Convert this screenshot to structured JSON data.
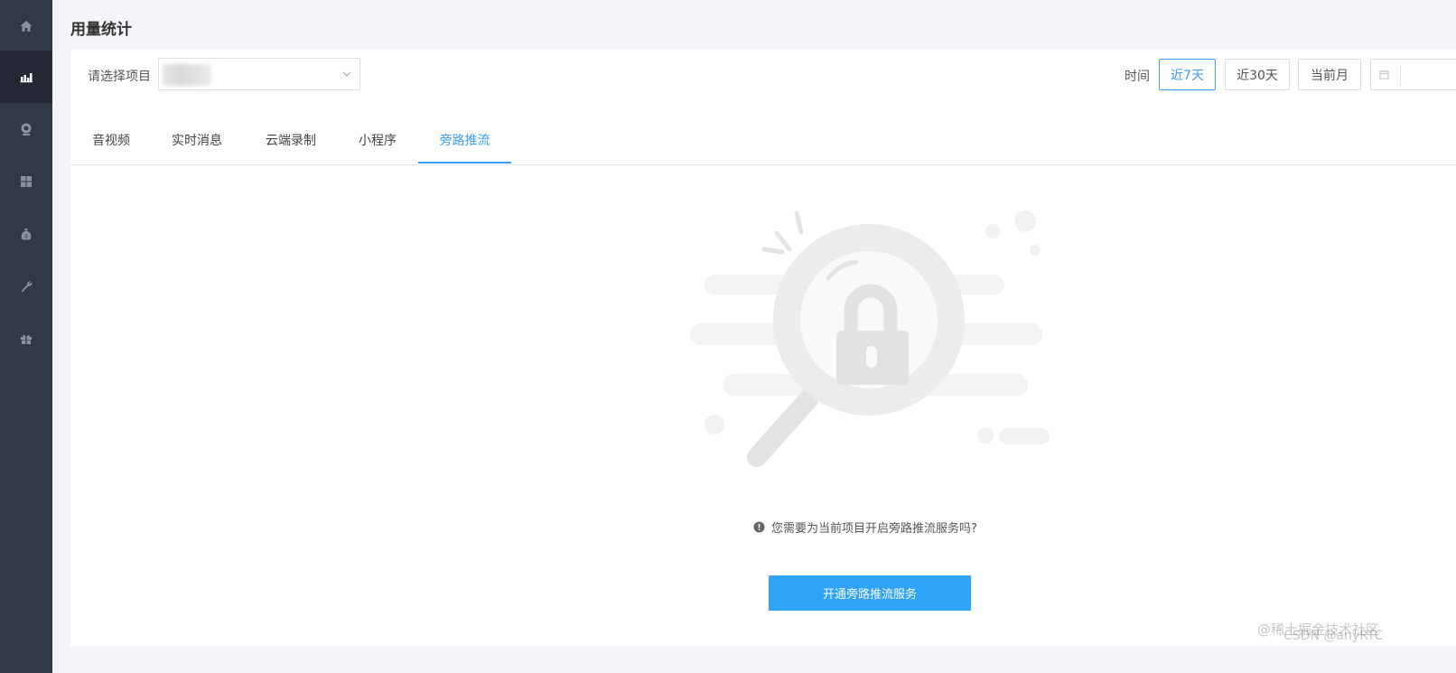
{
  "page": {
    "title": "用量统计"
  },
  "sidebar": {
    "items": [
      {
        "icon": "home-icon",
        "active": false
      },
      {
        "icon": "bar-chart-icon",
        "active": true
      },
      {
        "icon": "webcam-icon",
        "active": false
      },
      {
        "icon": "grid-icon",
        "active": false
      },
      {
        "icon": "money-bag-icon",
        "active": false
      },
      {
        "icon": "wrench-icon",
        "active": false
      },
      {
        "icon": "gift-icon",
        "active": false
      }
    ]
  },
  "filter": {
    "project_label": "请选择项目",
    "time_label": "时间",
    "ranges": [
      {
        "label": "近7天",
        "active": true
      },
      {
        "label": "近30天",
        "active": false
      },
      {
        "label": "当前月",
        "active": false
      }
    ]
  },
  "tabs": [
    {
      "label": "音视频",
      "active": false
    },
    {
      "label": "实时消息",
      "active": false
    },
    {
      "label": "云端录制",
      "active": false
    },
    {
      "label": "小程序",
      "active": false
    },
    {
      "label": "旁路推流",
      "active": true
    }
  ],
  "empty_state": {
    "illustration": "magnifier-lock-icon",
    "message": "您需要为当前项目开启旁路推流服务吗?",
    "action_label": "开通旁路推流服务"
  },
  "watermarks": {
    "juejin": "@稀土掘金技术社区",
    "csdn": "CSDN @anyRTC"
  },
  "colors": {
    "accent": "#3b9cf4",
    "button": "#2fa3f5",
    "sidebar": "#313848",
    "sidebar_active": "#232834"
  }
}
